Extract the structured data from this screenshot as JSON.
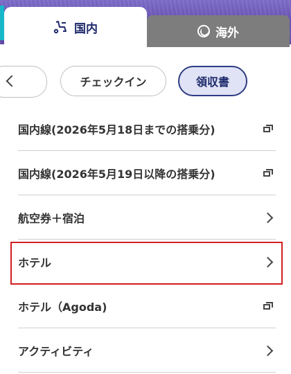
{
  "tabs": {
    "domestic": {
      "label": "国内",
      "icon": "seat-icon"
    },
    "overseas": {
      "label": "海外",
      "icon": "globe-icon"
    }
  },
  "chips": {
    "back_icon": "chevron-left-icon",
    "checkin": "チェックイン",
    "receipt": "領収書"
  },
  "list": {
    "items": [
      {
        "label": "国内線(2026年5月18日までの搭乗分)",
        "icon": "external-link-icon"
      },
      {
        "label": "国内線(2026年5月19日以降の搭乗分)",
        "icon": "external-link-icon"
      },
      {
        "label": "航空券＋宿泊",
        "icon": "chevron-right-icon"
      },
      {
        "label": "ホテル",
        "icon": "chevron-right-icon"
      },
      {
        "label": "ホテル（Agoda)",
        "icon": "external-link-icon"
      },
      {
        "label": "アクティビティ",
        "icon": "chevron-right-icon"
      }
    ]
  },
  "colors": {
    "accent": "#1f2a6b",
    "selected_chip_bg": "#dfe3f5",
    "inactive_tab": "#7d7d7d",
    "highlight": "#d11f1f"
  }
}
